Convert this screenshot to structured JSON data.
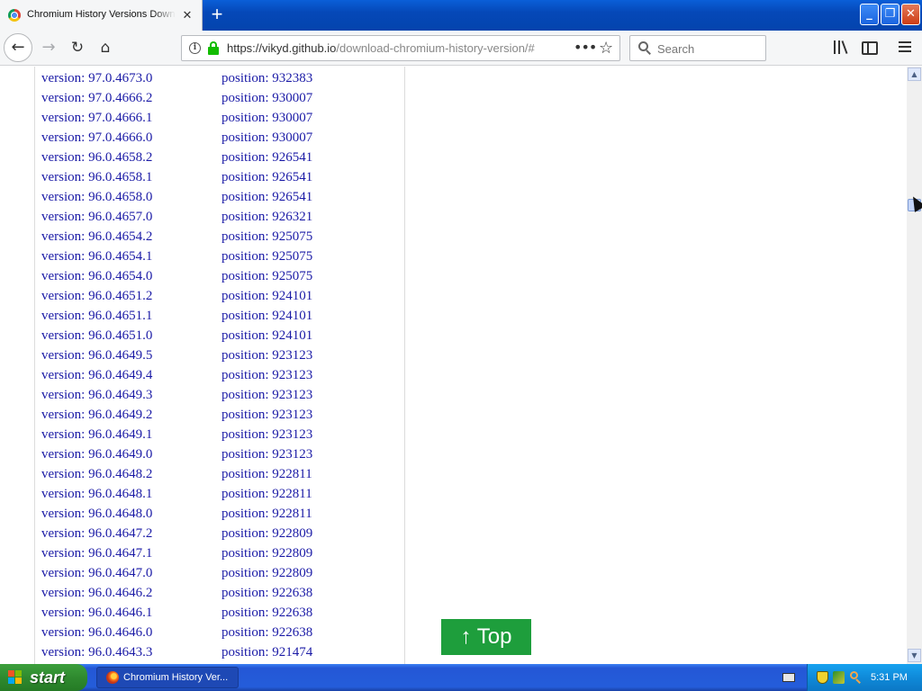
{
  "browser": {
    "tab_title": "Chromium History Versions Download",
    "tab_close": "✕",
    "new_tab": "+",
    "url_main": "https://vikyd.github.io",
    "url_rest": "/download-chromium-history-version/#",
    "search_placeholder": "Search",
    "window_controls": {
      "minimize": "_",
      "maximize": "❐",
      "close": "✕"
    },
    "icons": {
      "back": "←",
      "forward": "→",
      "reload": "↻",
      "home": "⌂",
      "page_actions": "•••",
      "bookmark_star": "☆"
    }
  },
  "page": {
    "version_prefix": "version: ",
    "position_prefix": "position: ",
    "rows": [
      {
        "version": "version: 97.0.4673.0",
        "position": "position: 932383"
      },
      {
        "version": "version: 97.0.4666.2",
        "position": "position: 930007"
      },
      {
        "version": "version: 97.0.4666.1",
        "position": "position: 930007"
      },
      {
        "version": "version: 97.0.4666.0",
        "position": "position: 930007"
      },
      {
        "version": "version: 96.0.4658.2",
        "position": "position: 926541"
      },
      {
        "version": "version: 96.0.4658.1",
        "position": "position: 926541"
      },
      {
        "version": "version: 96.0.4658.0",
        "position": "position: 926541"
      },
      {
        "version": "version: 96.0.4657.0",
        "position": "position: 926321"
      },
      {
        "version": "version: 96.0.4654.2",
        "position": "position: 925075"
      },
      {
        "version": "version: 96.0.4654.1",
        "position": "position: 925075"
      },
      {
        "version": "version: 96.0.4654.0",
        "position": "position: 925075"
      },
      {
        "version": "version: 96.0.4651.2",
        "position": "position: 924101"
      },
      {
        "version": "version: 96.0.4651.1",
        "position": "position: 924101"
      },
      {
        "version": "version: 96.0.4651.0",
        "position": "position: 924101"
      },
      {
        "version": "version: 96.0.4649.5",
        "position": "position: 923123"
      },
      {
        "version": "version: 96.0.4649.4",
        "position": "position: 923123"
      },
      {
        "version": "version: 96.0.4649.3",
        "position": "position: 923123"
      },
      {
        "version": "version: 96.0.4649.2",
        "position": "position: 923123"
      },
      {
        "version": "version: 96.0.4649.1",
        "position": "position: 923123"
      },
      {
        "version": "version: 96.0.4649.0",
        "position": "position: 923123"
      },
      {
        "version": "version: 96.0.4648.2",
        "position": "position: 922811"
      },
      {
        "version": "version: 96.0.4648.1",
        "position": "position: 922811"
      },
      {
        "version": "version: 96.0.4648.0",
        "position": "position: 922811"
      },
      {
        "version": "version: 96.0.4647.2",
        "position": "position: 922809"
      },
      {
        "version": "version: 96.0.4647.1",
        "position": "position: 922809"
      },
      {
        "version": "version: 96.0.4647.0",
        "position": "position: 922809"
      },
      {
        "version": "version: 96.0.4646.2",
        "position": "position: 922638"
      },
      {
        "version": "version: 96.0.4646.1",
        "position": "position: 922638"
      },
      {
        "version": "version: 96.0.4646.0",
        "position": "position: 922638"
      },
      {
        "version": "version: 96.0.4643.3",
        "position": "position: 921474"
      }
    ],
    "top_button_label": "↑ Top"
  },
  "taskbar": {
    "start_label": "start",
    "task_label": "Chromium History Ver...",
    "clock": "5:31 PM"
  },
  "colors": {
    "link_blue": "#1a1aa6",
    "top_button_green": "#1e9e3c",
    "lock_green": "#12bc00"
  }
}
